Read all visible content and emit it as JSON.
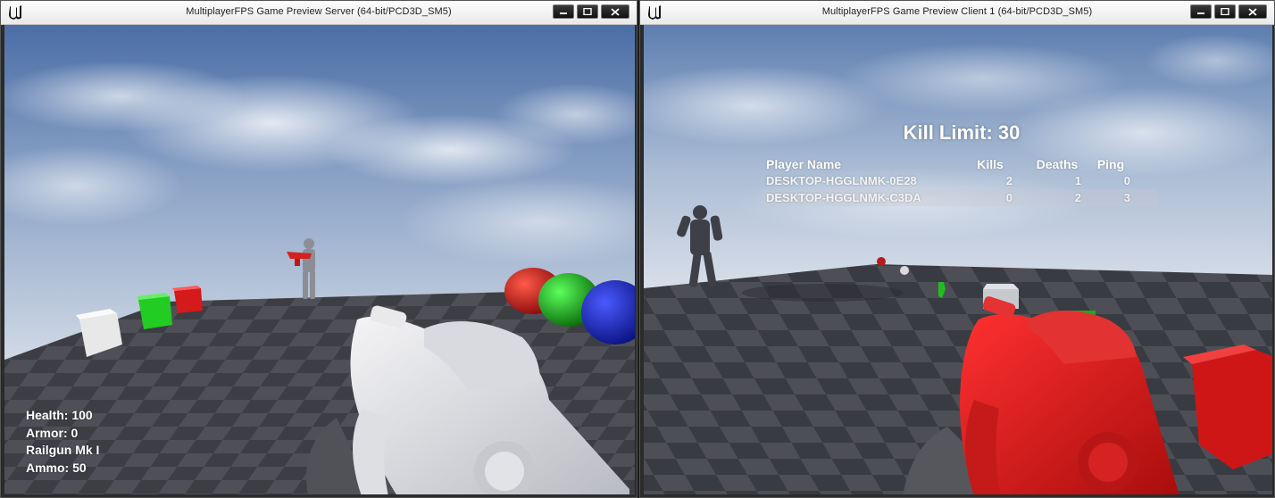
{
  "windows": {
    "server": {
      "title": "MultiplayerFPS Game Preview Server (64-bit/PCD3D_SM5)",
      "hud": {
        "health": "Health: 100",
        "armor": "Armor: 0",
        "weapon": "Railgun Mk I",
        "ammo": "Ammo: 50"
      }
    },
    "client": {
      "title": "MultiplayerFPS Game Preview Client 1 (64-bit/PCD3D_SM5)",
      "kill_limit": "Kill Limit: 30",
      "scoreboard": {
        "headers": {
          "name": "Player Name",
          "kills": "Kills",
          "deaths": "Deaths",
          "ping": "Ping"
        },
        "rows": [
          {
            "name": "DESKTOP-HGGLNMK-0E28",
            "kills": "2",
            "deaths": "1",
            "ping": "0"
          },
          {
            "name": "DESKTOP-HGGLNMK-C3DA",
            "kills": "0",
            "deaths": "2",
            "ping": "3"
          }
        ]
      }
    }
  },
  "colors": {
    "sky_top": "#4a6fa8",
    "sky_horizon": "#dde4ee",
    "floor_dark": "#3b3d44",
    "floor_light": "#55575f",
    "server_weapon": "#e6e6ea",
    "client_weapon": "#d81c1c"
  }
}
